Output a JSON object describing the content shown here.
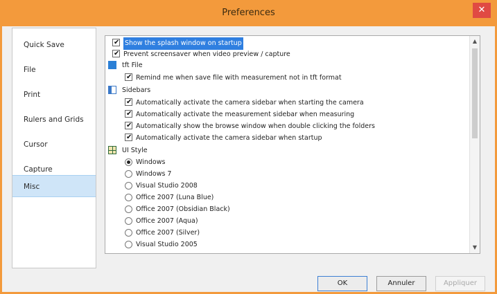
{
  "window": {
    "title": "Preferences",
    "close_symbol": "✕"
  },
  "sidebar": {
    "items": [
      {
        "label": "Quick Save",
        "active": false
      },
      {
        "label": "File",
        "active": false
      },
      {
        "label": "Print",
        "active": false
      },
      {
        "label": "Rulers and Grids",
        "active": false
      },
      {
        "label": "Cursor",
        "active": false
      },
      {
        "label": "Capture",
        "active": false
      },
      {
        "label": "Misc",
        "active": true
      }
    ]
  },
  "misc": {
    "show_splash": {
      "label": "Show the splash window on startup",
      "checked": true
    },
    "prevent_screensaver": {
      "label": "Prevent screensaver when video preview / capture",
      "checked": true
    },
    "tft_file": {
      "heading": "tft File",
      "remind": {
        "label": "Remind me when save file with measurement not in tft format",
        "checked": true
      }
    },
    "sidebars": {
      "heading": "Sidebars",
      "options": [
        {
          "label": "Automatically activate the camera sidebar when starting the camera",
          "checked": true
        },
        {
          "label": "Automatically activate the measurement sidebar when measuring",
          "checked": true
        },
        {
          "label": "Automatically show the browse window when double clicking the folders",
          "checked": true
        },
        {
          "label": "Automatically activate the camera sidebar when startup",
          "checked": true
        }
      ]
    },
    "ui_style": {
      "heading": "UI Style",
      "selected": "Windows",
      "options": [
        "Windows",
        "Windows 7",
        "Visual Studio 2008",
        "Office 2007 (Luna Blue)",
        "Office 2007 (Obsidian Black)",
        "Office 2007 (Aqua)",
        "Office 2007 (Silver)",
        "Visual Studio 2005"
      ]
    }
  },
  "footer": {
    "ok": "OK",
    "cancel": "Annuler",
    "apply": "Appliquer"
  },
  "colors": {
    "titlebar": "#f39a3c",
    "close": "#e04a43",
    "selection": "#2f7fe0",
    "nav_active": "#cfe5f8"
  },
  "icons": {
    "close": "close-icon",
    "tft": "file-icon",
    "sidebars": "sidebar-icon",
    "ui_style": "grid-icon"
  }
}
